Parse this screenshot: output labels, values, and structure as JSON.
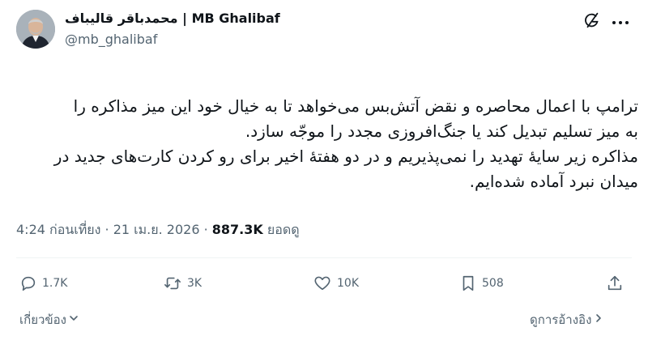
{
  "author": {
    "display_name": "محمدباقر قالیباف | MB Ghalibaf",
    "handle": "@mb_ghalibaf"
  },
  "tweet": {
    "lines": [
      "ترامپ با اعمال محاصره و نقض آتش‌بس می‌خواهد تا به خیال خود این میز مذاکره را",
      "به میز تسلیم تبدیل کند یا جنگ‌افروزی مجدد را موجّه سازد.",
      "مذاکره زیر سایهٔ تهدید را نمی‌پذیریم و در دو هفتهٔ اخیر برای رو کردن کارت‌های جدید در",
      "میدان نبرد آماده شده‌ایم."
    ]
  },
  "meta": {
    "timestamp": "4:24 ก่อนเที่ยง · 21 เม.ย. 2026 · ",
    "views_count": "887.3K",
    "views_label": " ยอดดู"
  },
  "actions": {
    "replies": "1.7K",
    "reposts": "3K",
    "likes": "10K",
    "bookmarks": "508"
  },
  "footer": {
    "related": "เกี่ยวข้อง",
    "quotes": "ดูการอ้างอิง"
  },
  "icons": [
    "grok-icon",
    "more-icon",
    "reply-icon",
    "repost-icon",
    "like-icon",
    "bookmark-icon",
    "share-icon",
    "chevron-down-icon",
    "chevron-right-icon"
  ],
  "colors": {
    "text": "#0f1419",
    "secondary": "#536471",
    "divider": "#eff3f4"
  }
}
